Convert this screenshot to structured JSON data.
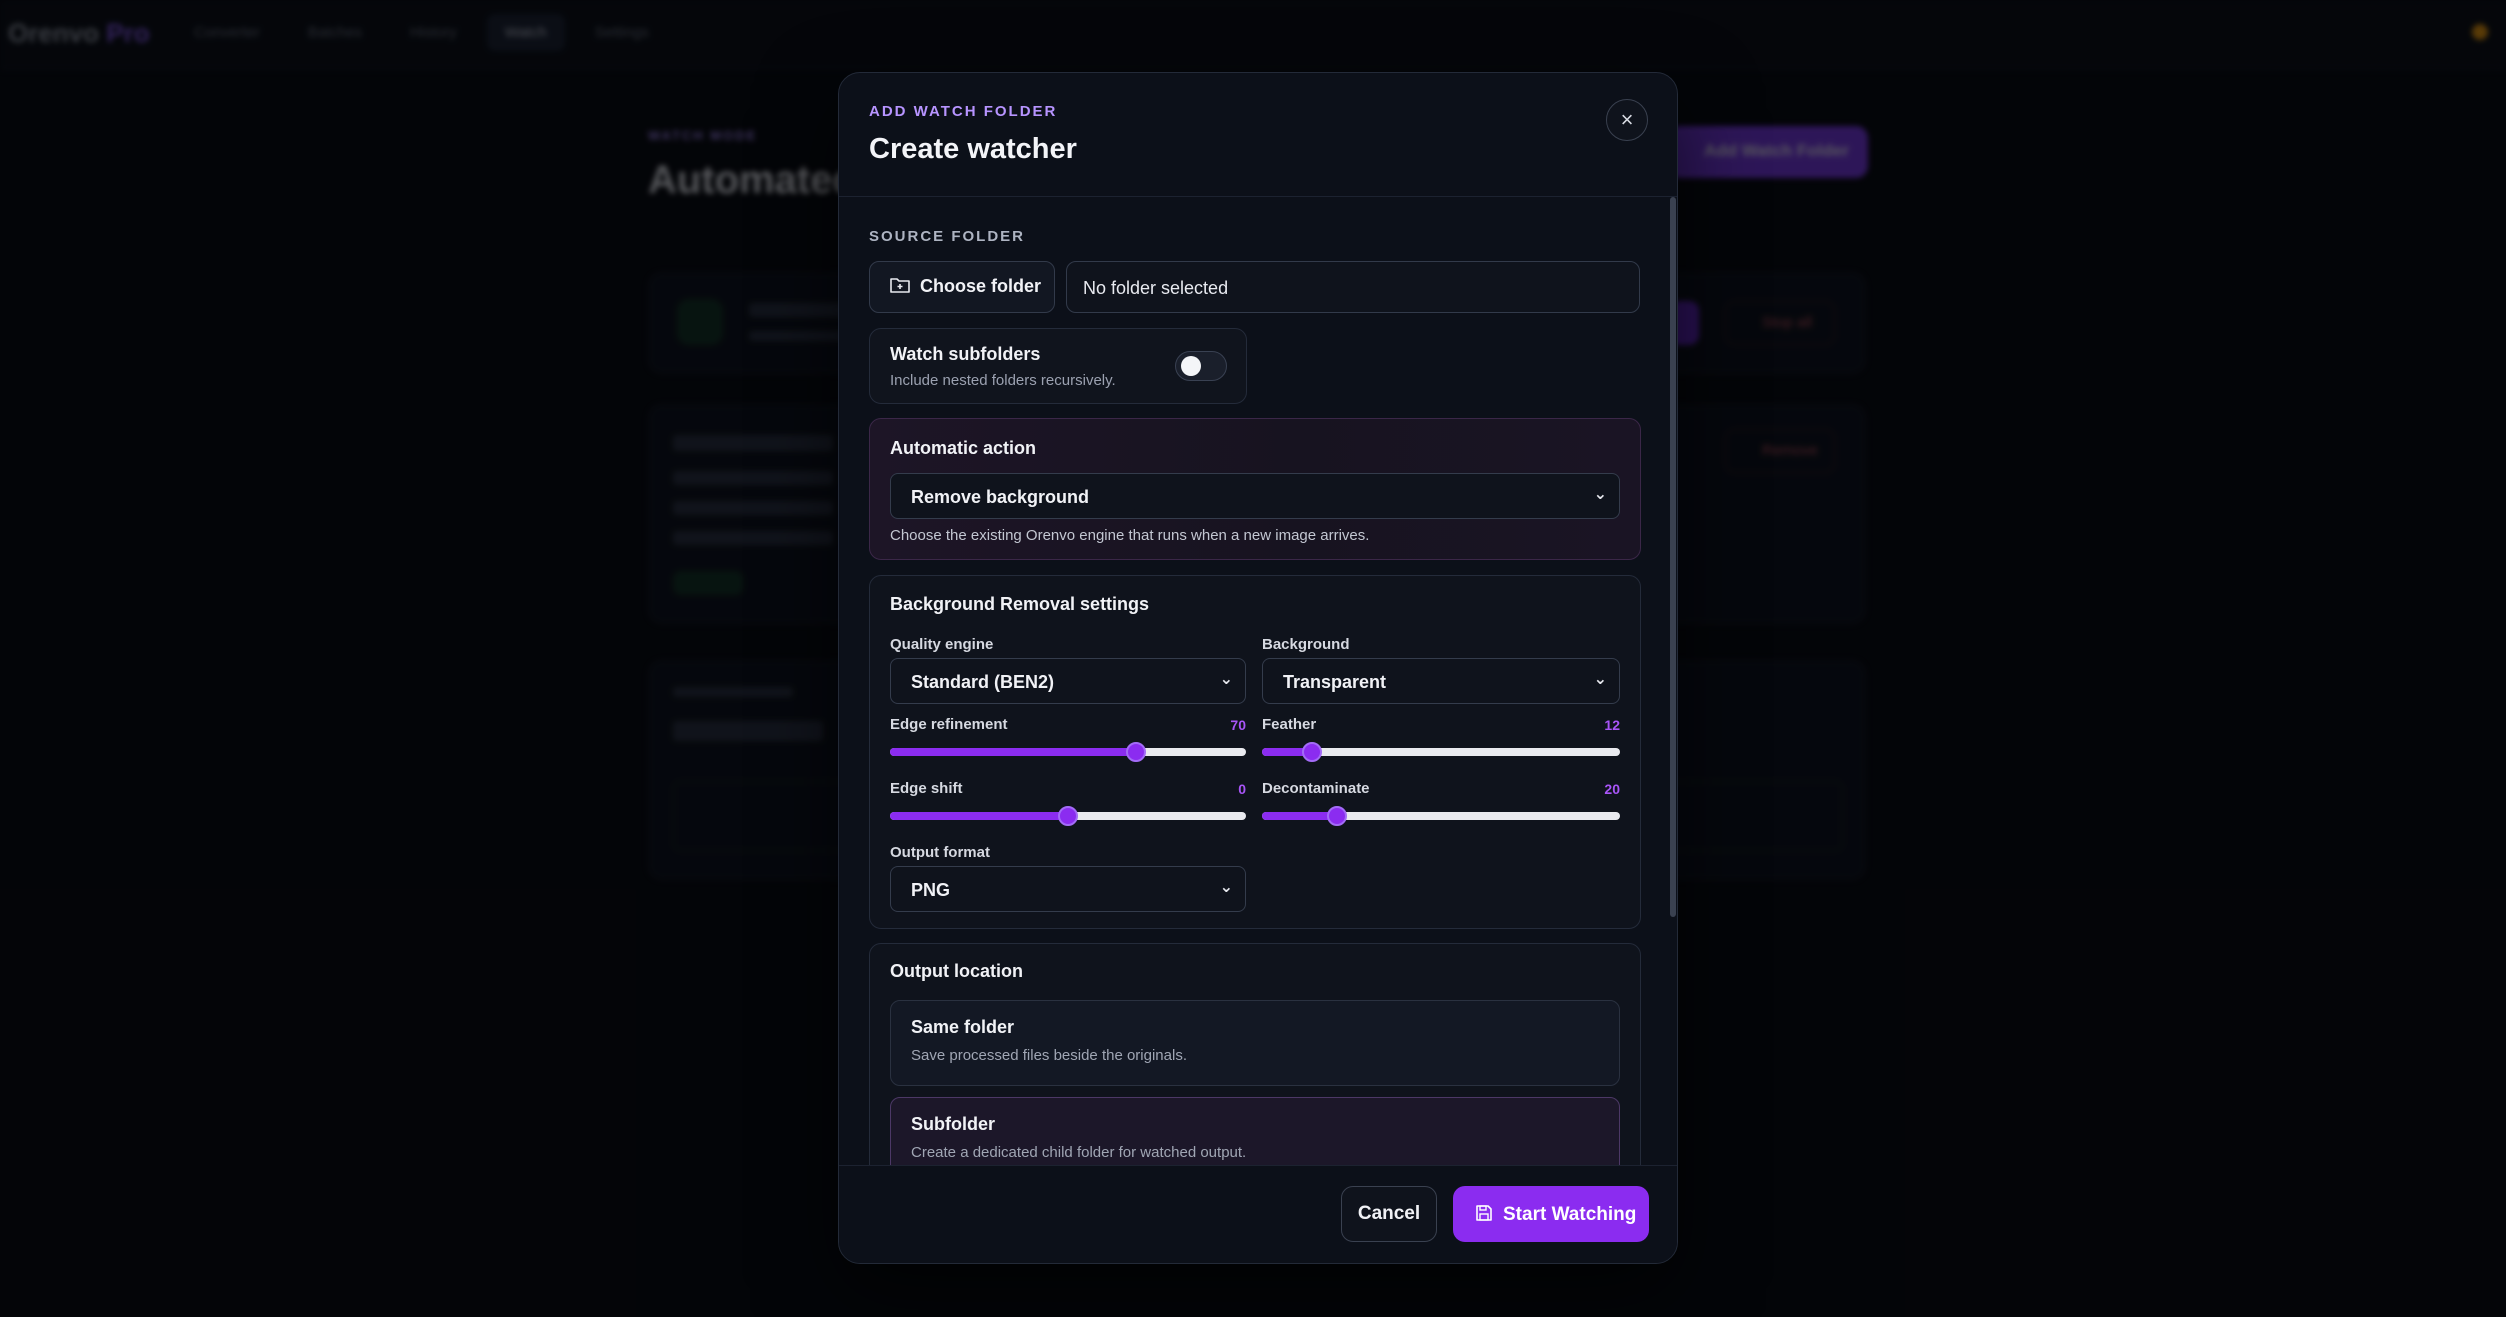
{
  "app": {
    "brand": "Orenvo",
    "brand_suffix": "Pro",
    "nav": [
      "Converter",
      "Batches",
      "History",
      "Watch",
      "Settings"
    ],
    "active_nav": "Watch"
  },
  "background": {
    "eyebrow": "WATCH MODE",
    "title": "Automated",
    "add_button": "Add Watch Folder",
    "stop_all": "Stop all",
    "remove": "Remove"
  },
  "modal": {
    "eyebrow": "ADD WATCH FOLDER",
    "title": "Create watcher",
    "close_icon": "close-icon",
    "source": {
      "label": "SOURCE FOLDER",
      "choose_label": "Choose folder",
      "folder_value": "No folder selected"
    },
    "subfolders": {
      "title": "Watch subfolders",
      "desc": "Include nested folders recursively.",
      "enabled": false
    },
    "automatic": {
      "title": "Automatic action",
      "selected": "Remove background",
      "help": "Choose the existing Orenvo engine that runs when a new image arrives."
    },
    "bg_removal": {
      "title": "Background Removal settings",
      "quality_label": "Quality engine",
      "quality_value": "Standard (BEN2)",
      "background_label": "Background",
      "background_value": "Transparent",
      "edge_refinement_label": "Edge refinement",
      "edge_refinement_value": "70",
      "feather_label": "Feather",
      "feather_value": "12",
      "edge_shift_label": "Edge shift",
      "edge_shift_value": "0",
      "decontaminate_label": "Decontaminate",
      "decontaminate_value": "20",
      "output_format_label": "Output format",
      "output_format_value": "PNG"
    },
    "output_location": {
      "title": "Output location",
      "options": [
        {
          "title": "Same folder",
          "desc": "Save processed files beside the originals."
        },
        {
          "title": "Subfolder",
          "desc": "Create a dedicated child folder for watched output."
        }
      ],
      "selected": "Subfolder"
    },
    "footer": {
      "cancel": "Cancel",
      "start": "Start Watching"
    }
  },
  "colors": {
    "accent": "#8b2cf0",
    "eyebrow": "#b794ff",
    "background": "#06080d",
    "modal": "#0c1019"
  }
}
